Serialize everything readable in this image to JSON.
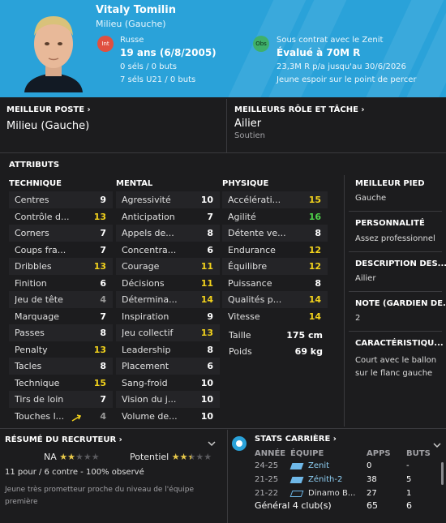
{
  "player": {
    "name": "Vitaly Tomilin",
    "position": "Milieu (Gauche)",
    "int_badge": "Int",
    "obs_badge": "Obs",
    "nationality": "Russe",
    "age": "19 ans (6/8/2005)",
    "selections": "0 séls / 0 buts",
    "selections_u21": "7 séls U21 / 0 buts",
    "contract": "Sous contrat avec le Zenit",
    "value": "Évalué à 70M R",
    "wage": "23,3M R p/a jusqu'au 30/6/2026",
    "status": "Jeune espoir sur le point de percer"
  },
  "best_position": {
    "title": "MEILLEUR POSTE",
    "value": "Milieu (Gauche)"
  },
  "best_role": {
    "title": "MEILLEURS RÔLE ET TÂCHE",
    "value": "Ailier",
    "sub": "Soutien"
  },
  "attributes": {
    "title": "ATTRIBUTS",
    "technique_title": "TECHNIQUE",
    "mental_title": "MENTAL",
    "physique_title": "PHYSIQUE",
    "technique": [
      {
        "name": "Centres",
        "value": "9",
        "color": "#ffffff"
      },
      {
        "name": "Contrôle d...",
        "value": "13",
        "color": "#f2d21c"
      },
      {
        "name": "Corners",
        "value": "7",
        "color": "#ffffff"
      },
      {
        "name": "Coups fra...",
        "value": "7",
        "color": "#ffffff"
      },
      {
        "name": "Dribbles",
        "value": "13",
        "color": "#f2d21c"
      },
      {
        "name": "Finition",
        "value": "6",
        "color": "#ffffff"
      },
      {
        "name": "Jeu de tête",
        "value": "4",
        "color": "#9a9a9a"
      },
      {
        "name": "Marquage",
        "value": "7",
        "color": "#ffffff"
      },
      {
        "name": "Passes",
        "value": "8",
        "color": "#ffffff"
      },
      {
        "name": "Penalty",
        "value": "13",
        "color": "#f2d21c"
      },
      {
        "name": "Tacles",
        "value": "8",
        "color": "#ffffff"
      },
      {
        "name": "Technique",
        "value": "15",
        "color": "#f2d21c"
      },
      {
        "name": "Tirs de loin",
        "value": "7",
        "color": "#ffffff"
      },
      {
        "name": "Touches l...",
        "value": "4",
        "color": "#9a9a9a"
      }
    ],
    "mental": [
      {
        "name": "Agressivité",
        "value": "10",
        "color": "#ffffff"
      },
      {
        "name": "Anticipation",
        "value": "7",
        "color": "#ffffff"
      },
      {
        "name": "Appels de...",
        "value": "8",
        "color": "#ffffff"
      },
      {
        "name": "Concentra...",
        "value": "6",
        "color": "#ffffff"
      },
      {
        "name": "Courage",
        "value": "11",
        "color": "#f2d21c"
      },
      {
        "name": "Décisions",
        "value": "11",
        "color": "#f2d21c"
      },
      {
        "name": "Détermina...",
        "value": "14",
        "color": "#f2d21c"
      },
      {
        "name": "Inspiration",
        "value": "9",
        "color": "#ffffff"
      },
      {
        "name": "Jeu collectif",
        "value": "13",
        "color": "#f2d21c"
      },
      {
        "name": "Leadership",
        "value": "8",
        "color": "#ffffff"
      },
      {
        "name": "Placement",
        "value": "6",
        "color": "#ffffff"
      },
      {
        "name": "Sang-froid",
        "value": "10",
        "color": "#ffffff"
      },
      {
        "name": "Vision du j...",
        "value": "10",
        "color": "#ffffff"
      },
      {
        "name": "Volume de...",
        "value": "10",
        "color": "#ffffff"
      }
    ],
    "physique": [
      {
        "name": "Accélérati...",
        "value": "15",
        "color": "#f2d21c"
      },
      {
        "name": "Agilité",
        "value": "16",
        "color": "#4fd14a"
      },
      {
        "name": "Détente ve...",
        "value": "8",
        "color": "#ffffff"
      },
      {
        "name": "Endurance",
        "value": "12",
        "color": "#f2d21c"
      },
      {
        "name": "Équilibre",
        "value": "12",
        "color": "#f2d21c"
      },
      {
        "name": "Puissance",
        "value": "8",
        "color": "#ffffff"
      },
      {
        "name": "Qualités p...",
        "value": "14",
        "color": "#f2d21c"
      },
      {
        "name": "Vitesse",
        "value": "14",
        "color": "#f2d21c"
      }
    ],
    "height_label": "Taille",
    "height": "175 cm",
    "weight_label": "Poids",
    "weight": "69 kg"
  },
  "side": {
    "foot_title": "MEILLEUR PIED",
    "foot": "Gauche",
    "personality_title": "PERSONNALITÉ",
    "personality": "Assez professionnel",
    "description_title": "DESCRIPTION DES...",
    "description": "Ailier",
    "gk_title": "NOTE (GARDIEN DE...",
    "gk": "2",
    "traits_title": "CARACTÉRISTIQU...",
    "traits": "Court avec le ballon sur le flanc gauche"
  },
  "scout": {
    "title": "RÉSUMÉ DU RECRUTEUR",
    "na_label": "NA",
    "potential_label": "Potentiel",
    "na_stars": 2,
    "potential_stars": 2.5,
    "summary": "11 pour / 6 contre - 100% observé",
    "comment": "Jeune très prometteur proche du niveau de l'équipe première"
  },
  "career": {
    "title": "STATS CARRIÈRE",
    "headers": {
      "year": "ANNÉE",
      "team": "ÉQUIPE",
      "apps": "APPS",
      "goals": "BUTS"
    },
    "rows": [
      {
        "year": "24-25",
        "team": "Zenit",
        "apps": "0",
        "goals": "-"
      },
      {
        "year": "21-25",
        "team": "Zénith-2",
        "apps": "38",
        "goals": "5"
      },
      {
        "year": "21-22",
        "team": "Dinamo B...",
        "apps": "27",
        "goals": "1"
      }
    ],
    "total_label": "Général 4 club(s)",
    "total_apps": "65",
    "total_goals": "6"
  }
}
